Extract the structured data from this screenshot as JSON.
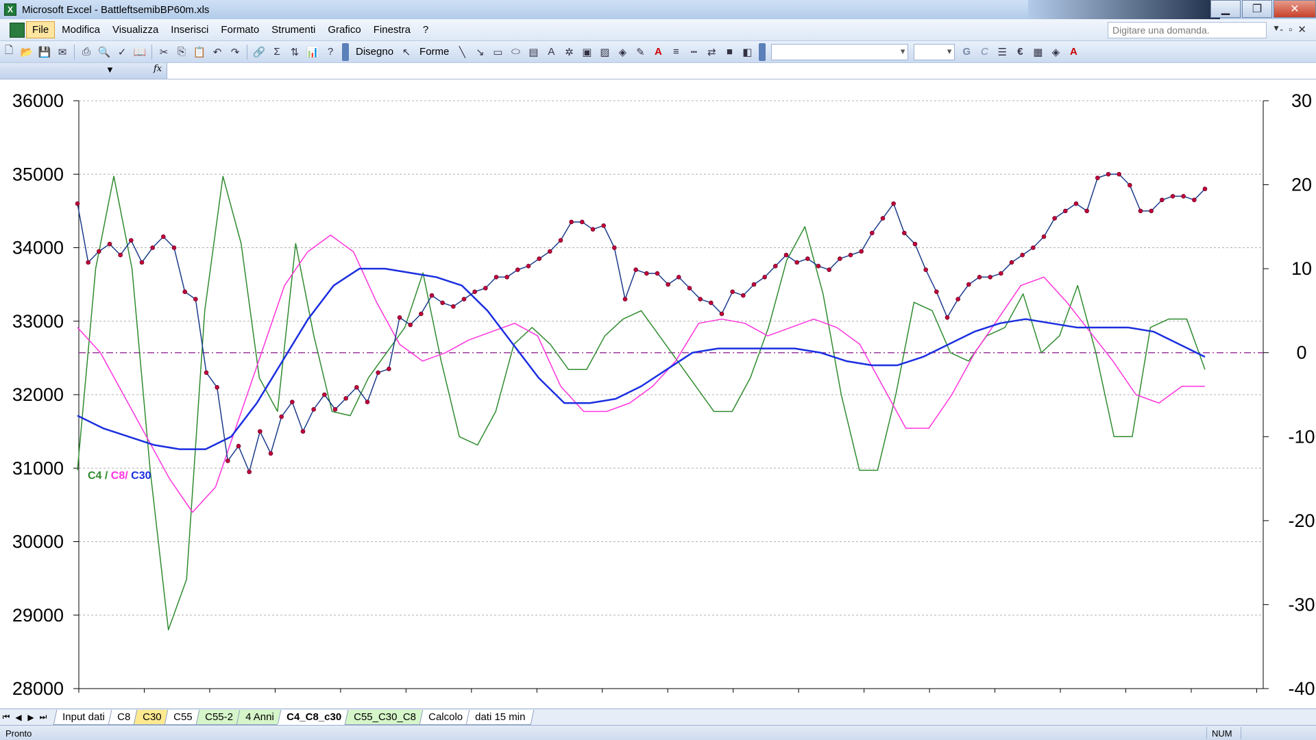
{
  "window": {
    "title": "Microsoft Excel - BattleftsemibBP60m.xls",
    "minimize_icon": "minimize-icon",
    "maximize_icon": "maximize-icon",
    "close_icon": "close-icon"
  },
  "menu": {
    "items": [
      "File",
      "Modifica",
      "Visualizza",
      "Inserisci",
      "Formato",
      "Strumenti",
      "Grafico",
      "Finestra",
      "?"
    ],
    "ask_placeholder": "Digitare una domanda."
  },
  "toolbar": {
    "draw_label": "Disegno",
    "shapes_label": "Forme",
    "bold_label": "G",
    "italic_label": "C",
    "euro_label": "€"
  },
  "namebar": {
    "fx_label": "fx"
  },
  "chart_data": {
    "type": "line",
    "y_left": {
      "min": 28000,
      "max": 36000,
      "ticks": [
        28000,
        29000,
        30000,
        31000,
        32000,
        33000,
        34000,
        35000,
        36000
      ]
    },
    "y_right": {
      "min": -40,
      "max": 30,
      "ticks": [
        -40,
        -30,
        -20,
        -10,
        0,
        10,
        20,
        30
      ]
    },
    "grid": "horizontal dashed",
    "legend": {
      "c4": "C4",
      "sep1": " / ",
      "c8": "C8/",
      "c30": " C30"
    },
    "colors": {
      "price": "#1a3a8a",
      "marker": "#c0003a",
      "c4": "#2e8b2e",
      "c8": "#ff33dd",
      "c30": "#1a2ee0",
      "zero": "#9a3b9a"
    },
    "price_series": {
      "name": "",
      "axis": "left",
      "values": [
        34600,
        33800,
        33950,
        34050,
        33900,
        34100,
        33800,
        34000,
        34150,
        34000,
        33400,
        33300,
        32300,
        32100,
        31100,
        31300,
        30950,
        31500,
        31200,
        31700,
        31900,
        31500,
        31800,
        32000,
        31800,
        31950,
        32100,
        31900,
        32300,
        32350,
        33050,
        32950,
        33100,
        33350,
        33250,
        33200,
        33300,
        33400,
        33450,
        33600,
        33600,
        33700,
        33750,
        33850,
        33950,
        34100,
        34350,
        34350,
        34250,
        34300,
        34000,
        33300,
        33700,
        33650,
        33650,
        33500,
        33600,
        33450,
        33300,
        33250,
        33100,
        33400,
        33350,
        33500,
        33600,
        33750,
        33900,
        33800,
        33850,
        33750,
        33700,
        33850,
        33900,
        33950,
        34200,
        34400,
        34600,
        34200,
        34050,
        33700,
        33400,
        33050,
        33300,
        33500,
        33600,
        33600,
        33650,
        33800,
        33900,
        34000,
        34150,
        34400,
        34500,
        34600,
        34500,
        34950,
        35000,
        35000,
        34850,
        34500,
        34500,
        34650,
        34700,
        34700,
        34650,
        34800
      ]
    },
    "c30_series": {
      "name": "C30",
      "axis": "right",
      "values": [
        -7.5,
        -9,
        -10,
        -11,
        -11.5,
        -11.5,
        -10,
        -6,
        -1,
        4,
        8,
        10,
        10,
        9.5,
        9,
        8,
        5,
        1,
        -3,
        -6,
        -6,
        -5.5,
        -4,
        -2,
        0,
        0.5,
        0.5,
        0.5,
        0.5,
        0,
        -1,
        -1.5,
        -1.5,
        -0.5,
        1,
        2.5,
        3.5,
        4,
        3.5,
        3,
        3,
        3,
        2.5,
        1,
        -0.5
      ]
    },
    "c8_series": {
      "name": "C8",
      "axis": "right",
      "values": [
        3,
        0,
        -5,
        -10,
        -15,
        -19,
        -16,
        -8,
        0,
        8,
        12,
        14,
        12,
        6,
        1,
        -1,
        0,
        1.5,
        2.5,
        3.5,
        2,
        -4,
        -7,
        -7,
        -6,
        -4,
        -1,
        3.5,
        4,
        3.5,
        2,
        3,
        4,
        3,
        1,
        -4,
        -9,
        -9,
        -5,
        0,
        4,
        8,
        9,
        6,
        2.5,
        -1,
        -5,
        -6,
        -4,
        -4
      ]
    },
    "c4_series": {
      "name": "C4",
      "axis": "right",
      "values": [
        -14,
        10,
        21,
        10,
        -14,
        -33,
        -27,
        5,
        21,
        13,
        -3,
        -7,
        13,
        2,
        -7,
        -7.5,
        -3,
        0,
        3,
        9.5,
        -1,
        -10,
        -11,
        -7,
        1,
        3,
        1,
        -2,
        -2,
        2,
        4,
        5,
        2,
        -1,
        -4,
        -7,
        -7,
        -3,
        3,
        11,
        15,
        7,
        -5,
        -14,
        -14,
        -5,
        6,
        5,
        0,
        -1,
        2,
        3,
        7,
        0,
        2,
        8,
        0,
        -10,
        -10,
        3,
        4,
        4,
        -2
      ]
    },
    "x_tick_count": 18
  },
  "sheet_tabs": [
    {
      "label": "Input dati",
      "style": "white"
    },
    {
      "label": "C8",
      "style": "white"
    },
    {
      "label": "C30",
      "style": "yellow"
    },
    {
      "label": "C55",
      "style": "white"
    },
    {
      "label": "C55-2",
      "style": "green"
    },
    {
      "label": "4 Anni",
      "style": "green"
    },
    {
      "label": "C4_C8_c30",
      "style": "active"
    },
    {
      "label": "C55_C30_C8",
      "style": "green"
    },
    {
      "label": "Calcolo",
      "style": "white"
    },
    {
      "label": "dati 15 min",
      "style": "white"
    }
  ],
  "status": {
    "ready": "Pronto",
    "num": "NUM"
  }
}
